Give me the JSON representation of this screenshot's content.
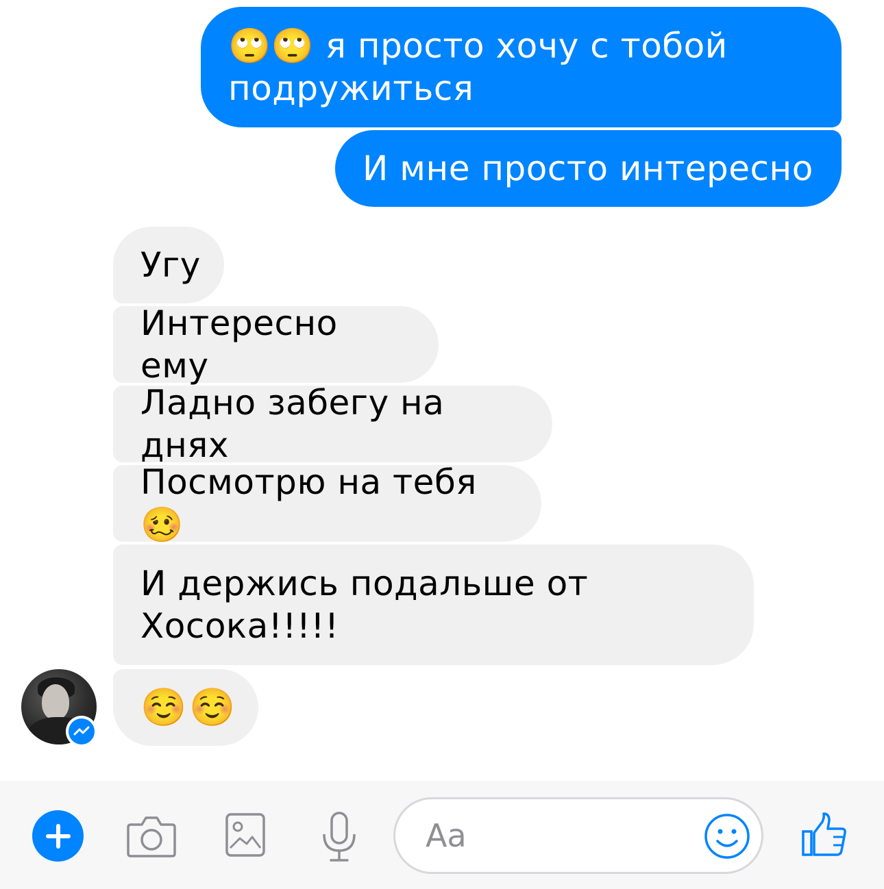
{
  "messages": {
    "outgoing": [
      {
        "emoji": "🙄🙄",
        "text": " я просто хочу с тобой\nподружиться"
      },
      {
        "text": "И мне просто интересно"
      }
    ],
    "incoming": [
      {
        "text": "Угу"
      },
      {
        "text": "Интересно ему"
      },
      {
        "text": "Ладно забегу на днях"
      },
      {
        "text": "Посмотрю на тебя",
        "emoji": "🥴"
      },
      {
        "text": "И держись подальше от\nХосока!!!!!"
      },
      {
        "emoji": "☺️☺️"
      }
    ]
  },
  "composer": {
    "placeholder": "Aa"
  },
  "icons": {
    "plus": "plus-icon",
    "camera": "camera-icon",
    "gallery": "gallery-icon",
    "mic": "microphone-icon",
    "emoji": "smiley-icon",
    "like": "thumbs-up-icon",
    "badge": "messenger-icon"
  },
  "colors": {
    "accent": "#0084ff",
    "incoming_bubble": "#f1f0f0",
    "composer_bg": "#f7f7f8"
  }
}
